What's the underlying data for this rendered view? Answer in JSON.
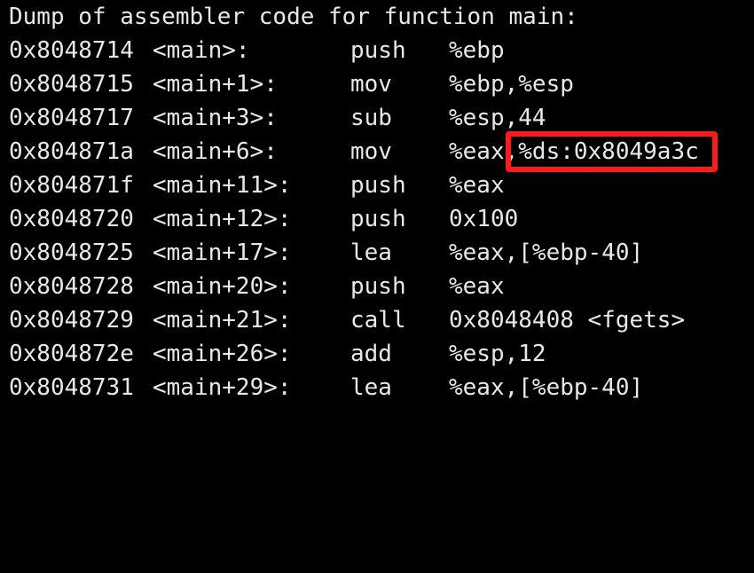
{
  "terminal": {
    "header": "Dump of assembler code for function main:",
    "rows": [
      {
        "addr": "0x8048714",
        "sym": "<main>:",
        "mnem": "push",
        "ops": "%ebp"
      },
      {
        "addr": "0x8048715",
        "sym": "<main+1>:",
        "mnem": "mov",
        "ops": "%ebp,%esp"
      },
      {
        "addr": "0x8048717",
        "sym": "<main+3>:",
        "mnem": "sub",
        "ops": "%esp,44"
      },
      {
        "addr": "0x804871a",
        "sym": "<main+6>:",
        "mnem": "mov",
        "ops": "%eax,%ds:0x8049a3c"
      },
      {
        "addr": "0x804871f",
        "sym": "<main+11>:",
        "mnem": "push",
        "ops": "%eax"
      },
      {
        "addr": "0x8048720",
        "sym": "<main+12>:",
        "mnem": "push",
        "ops": "0x100"
      },
      {
        "addr": "0x8048725",
        "sym": "<main+17>:",
        "mnem": "lea",
        "ops": "%eax,[%ebp-40]"
      },
      {
        "addr": "0x8048728",
        "sym": "<main+20>:",
        "mnem": "push",
        "ops": "%eax"
      },
      {
        "addr": "0x8048729",
        "sym": "<main+21>:",
        "mnem": "call",
        "ops": "0x8048408 <fgets>"
      },
      {
        "addr": "0x804872e",
        "sym": "<main+26>:",
        "mnem": "add",
        "ops": "%esp,12"
      },
      {
        "addr": "0x8048731",
        "sym": "<main+29>:",
        "mnem": "lea",
        "ops": "%eax,[%ebp-40]"
      }
    ],
    "highlight_text": "%ds:0x8049a3c",
    "highlight_color": "#ff1a1a",
    "text_color": "#e8e8e8",
    "background_color": "#000000"
  }
}
